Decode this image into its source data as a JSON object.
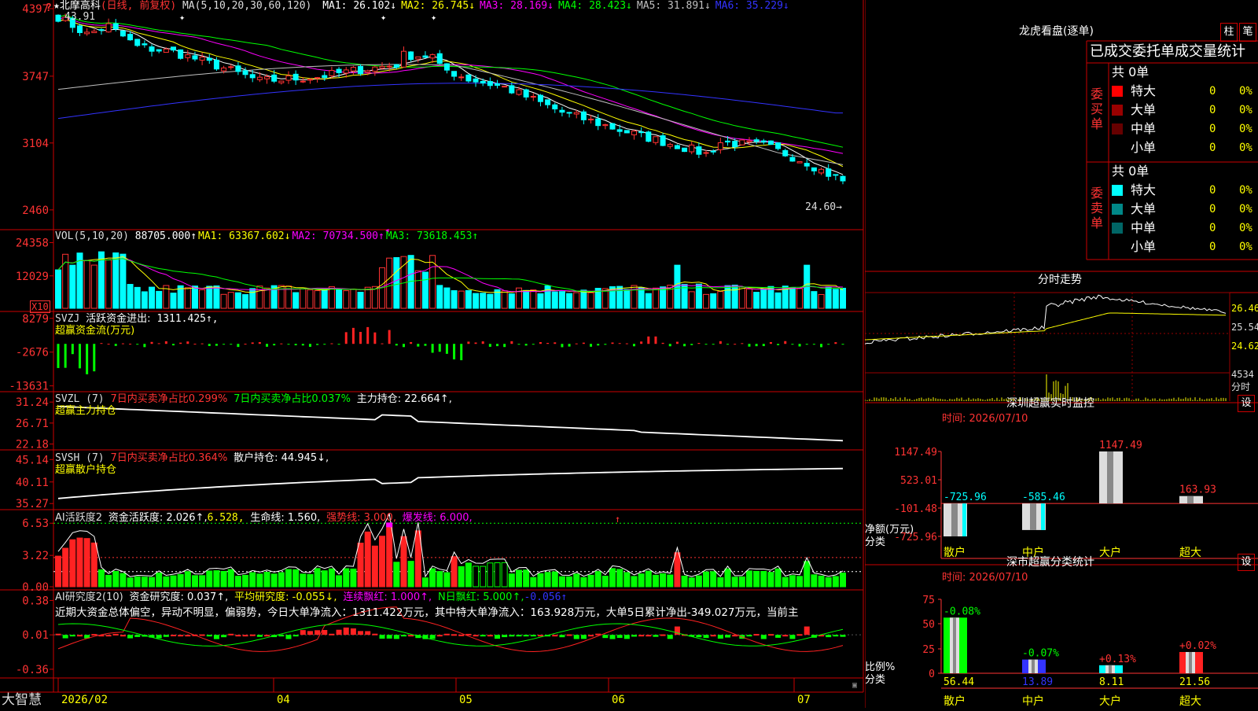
{
  "stock": {
    "name": "北摩高科",
    "period": "(日线, 前复权)",
    "top_left_value": "43.91",
    "current_price_label": "24.60→"
  },
  "main_indicator": {
    "title": "MA(5,10,20,30,60,120)",
    "readouts": [
      {
        "label": "MA1:",
        "value": "26.102↓",
        "color": "#ffffff"
      },
      {
        "label": "MA2:",
        "value": "26.745↓",
        "color": "#ffff00"
      },
      {
        "label": "MA3:",
        "value": "28.169↓",
        "color": "#ff00ff"
      },
      {
        "label": "MA4:",
        "value": "28.423↓",
        "color": "#00ff00"
      },
      {
        "label": "MA5:",
        "value": "31.891↓",
        "color": "#c0c0c0"
      },
      {
        "label": "MA6:",
        "value": "35.229↓",
        "color": "#3333ff"
      }
    ]
  },
  "vol_indicator": {
    "title": "VOL(5,10,20)",
    "value": "88705.000↑",
    "readouts": [
      {
        "label": "MA1:",
        "value": "63367.602↓",
        "color": "#ffff00"
      },
      {
        "label": "MA2:",
        "value": "70734.500↑",
        "color": "#ff00ff"
      },
      {
        "label": "MA3:",
        "value": "73618.453↑",
        "color": "#00ff00"
      }
    ],
    "unit": "X10"
  },
  "svzj": {
    "name": "SVZJ",
    "label": "活跃资金进出:",
    "value": "1311.425↑,",
    "subtitle": "超赢资金流(万元)"
  },
  "svzl": {
    "name": "SVZL (7)",
    "t1": "7日内买卖净占比0.299%",
    "t2": "7日内买卖净占比0.037%",
    "t3": "主力持仓: 22.664↑,",
    "subtitle": "超赢主力持仓"
  },
  "svsh": {
    "name": "SVSH (7)",
    "t1": "7日内买卖净占比0.364%",
    "t3": "散户持仓: 44.945↓,",
    "subtitle": "超赢散户持仓"
  },
  "ai_active": {
    "name": "AI活跃度2",
    "t1": "资金活跃度: 2.026↑,",
    "t2": "6.528,",
    "t3": "生命线: 1.560,",
    "t4": "强势线: 3.000,",
    "t5": "爆发线: 6.000,"
  },
  "ai_research": {
    "name": "AI研究度2(10)",
    "t1": "资金研究度: 0.037↑,",
    "t2": "平均研究度: -0.055↓,",
    "t3": "连续飘红: 1.000↑,",
    "t4": "N日飘红: 5.000↑,",
    "t5": "-0.056↑",
    "comment": "近期大资金总体偏空，异动不明显，偏弱势，今日大单净流入：1311.422万元，其中特大单净流入：163.928万元，大单5日累计净出-349.027万元，当前主"
  },
  "axes": {
    "price": [
      "4397",
      "3747",
      "3104",
      "2460"
    ],
    "vol": [
      "24358",
      "12029"
    ],
    "svzj": [
      "8279",
      "-2676",
      "-13631"
    ],
    "svzl": [
      "31.24",
      "26.71",
      "22.18"
    ],
    "svsh": [
      "45.14",
      "40.11",
      "35.27"
    ],
    "ai_active": [
      "6.53",
      "3.22",
      "0.00"
    ],
    "ai_research": [
      "0.38",
      "0.01",
      "-0.36"
    ]
  },
  "dates": [
    "2026/02",
    "04",
    "05",
    "06",
    "07"
  ],
  "brand": "大智慧",
  "side": {
    "lhkp_title": "龙虎看盘(逐单)",
    "btn_col": "柱",
    "btn_pen": "笔",
    "table_header": "已成交委托单成交量统计",
    "buy_label": "委买单",
    "sell_label": "委卖单",
    "total_label": "共 0单",
    "buy_rows": [
      {
        "name": "特大",
        "count": "0",
        "pct": "0%",
        "color": "#ff0000"
      },
      {
        "name": "大单",
        "count": "0",
        "pct": "0%",
        "color": "#990000"
      },
      {
        "name": "中单",
        "count": "0",
        "pct": "0%",
        "color": "#660000"
      },
      {
        "name": "小单",
        "count": "0",
        "pct": "0%",
        "color": ""
      }
    ],
    "sell_rows": [
      {
        "name": "特大",
        "count": "0",
        "pct": "0%",
        "color": "#00ffff"
      },
      {
        "name": "大单",
        "count": "0",
        "pct": "0%",
        "color": "#008888"
      },
      {
        "name": "中单",
        "count": "0",
        "pct": "0%",
        "color": "#006666"
      },
      {
        "name": "小单",
        "count": "0",
        "pct": "0%",
        "color": ""
      }
    ],
    "intraday_title": "分时走势",
    "intraday_y": [
      "26.46",
      "25.54",
      "24.62"
    ],
    "intraday_vol": "4534",
    "intraday_vol_label": "分时",
    "monitor_title": "深圳超赢实时监控",
    "settings": "设",
    "time_label": "时间: 2026/07/10",
    "monitor_y": [
      "1147.49",
      "523.01",
      "-101.48",
      "-725.96"
    ],
    "monitor_axis_label1": "净额(万元)",
    "monitor_axis_label2": "分类",
    "categories": [
      "散户",
      "中户",
      "大户",
      "超大"
    ],
    "net_values": [
      -725.96,
      -585.46,
      1147.49,
      163.93
    ],
    "net_labels": [
      "-725.96",
      "-585.46",
      "1147.49",
      "163.93"
    ],
    "stats_title": "深市超赢分类统计",
    "stats_y": [
      "75",
      "50",
      "25",
      "0"
    ],
    "stats_axis_label1": "比例%",
    "stats_axis_label2": "分类",
    "stats_values": [
      56.44,
      13.89,
      8.11,
      21.56
    ],
    "stats_values_text": [
      "56.44",
      "13.89",
      "8.11",
      "21.56"
    ],
    "stats_changes": [
      "-0.08%",
      "-0.07%",
      "+0.13%",
      "+0.02%"
    ],
    "stats_colors": [
      "#00ff00",
      "#3333ff",
      "#00ffff",
      "#ff2222"
    ]
  },
  "chart_data": [
    {
      "type": "candlestick",
      "title": "北摩高科",
      "series": [
        "MA1",
        "MA2",
        "MA3",
        "MA4",
        "MA5",
        "MA6"
      ],
      "ylim": [
        2300,
        4450
      ],
      "last": 24.6
    },
    {
      "type": "bar",
      "title": "VOL(5,10,20)",
      "ylim": [
        0,
        28000
      ]
    },
    {
      "type": "bar",
      "title": "SVZJ",
      "ylim": [
        -13631,
        8279
      ]
    },
    {
      "type": "line",
      "title": "SVZL (7)",
      "ylim": [
        22.18,
        31.24
      ]
    },
    {
      "type": "line",
      "title": "SVSH (7)",
      "ylim": [
        35.27,
        45.14
      ]
    },
    {
      "type": "bar",
      "title": "AI活跃度2",
      "ylim": [
        0,
        6.53
      ]
    },
    {
      "type": "bar",
      "title": "AI研究度2(10)",
      "ylim": [
        -0.36,
        0.38
      ]
    }
  ]
}
